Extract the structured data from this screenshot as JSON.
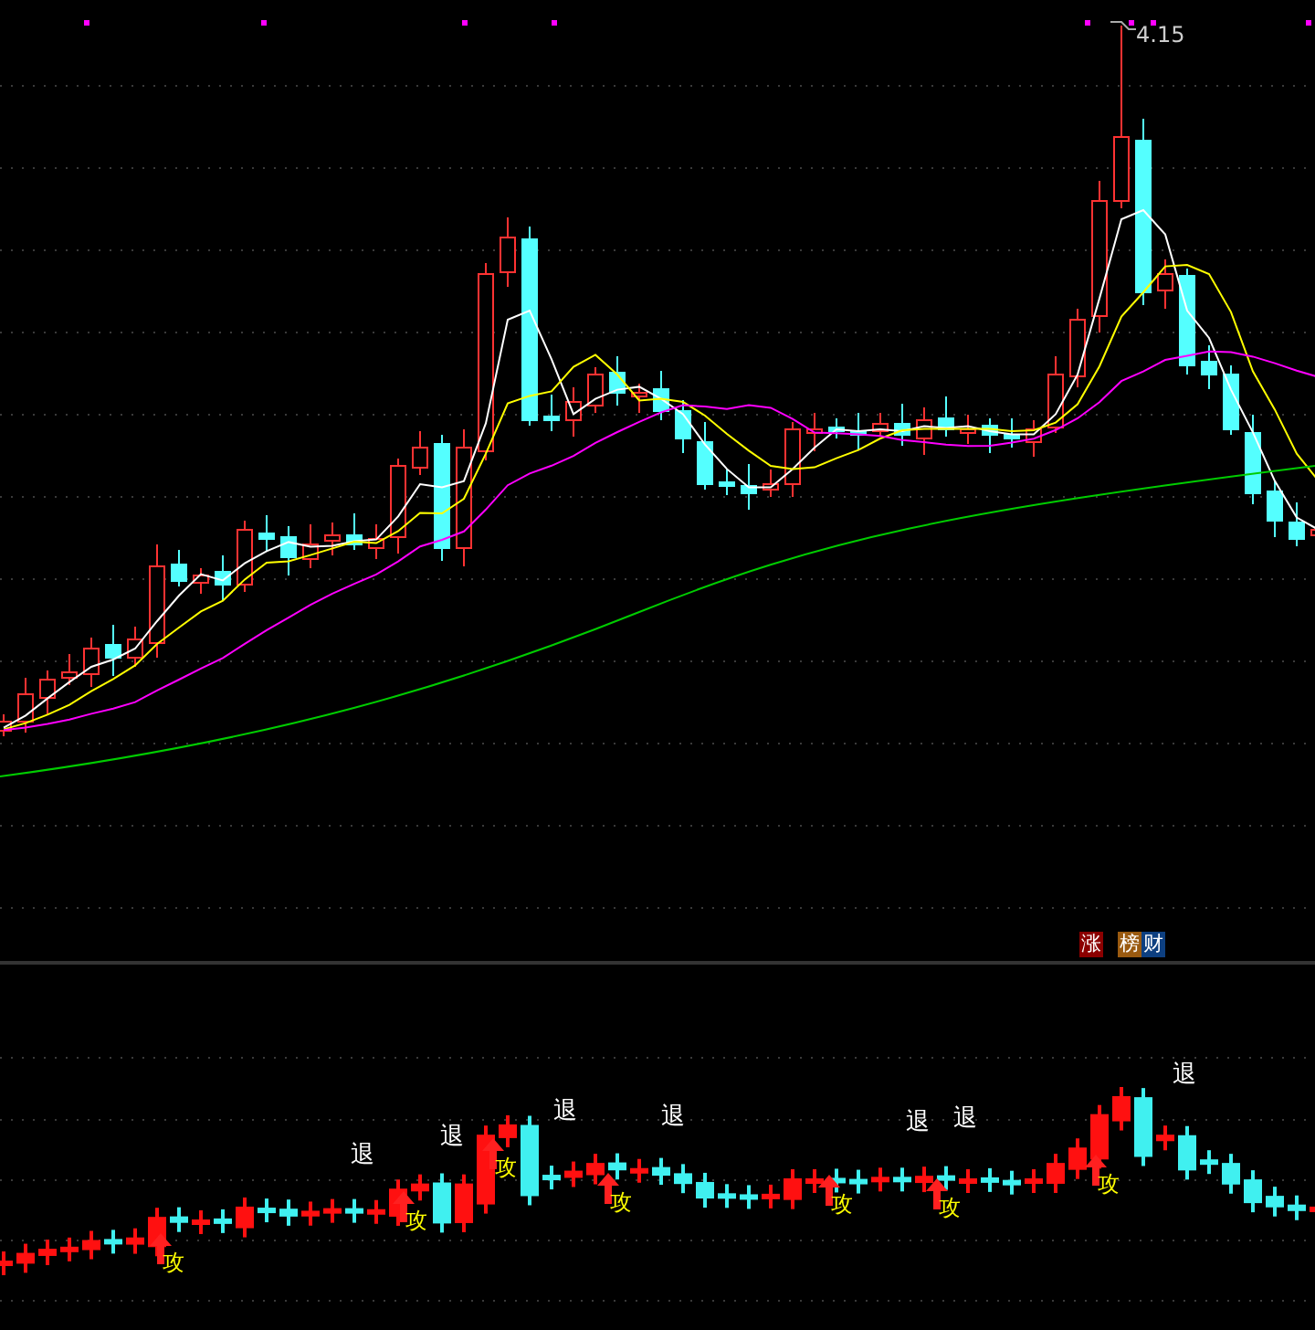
{
  "price_panel": {
    "high_label": "4.15"
  },
  "badges": [
    {
      "text": "涨",
      "color": "#8b0000"
    },
    {
      "text": "榜",
      "color": "#9a5a10"
    },
    {
      "text": "财",
      "color": "#0d3f80"
    }
  ],
  "indicator_panel": {
    "signals": [
      {
        "kind": "attack",
        "text": "攻"
      },
      {
        "kind": "retreat",
        "text": "退"
      },
      {
        "kind": "attack",
        "text": "攻"
      },
      {
        "kind": "retreat",
        "text": "退"
      },
      {
        "kind": "attack",
        "text": "攻"
      },
      {
        "kind": "retreat",
        "text": "退"
      },
      {
        "kind": "attack",
        "text": "攻"
      },
      {
        "kind": "retreat",
        "text": "退"
      },
      {
        "kind": "attack",
        "text": "攻"
      },
      {
        "kind": "retreat",
        "text": "退"
      },
      {
        "kind": "attack",
        "text": "攻"
      },
      {
        "kind": "retreat",
        "text": "退"
      },
      {
        "kind": "attack",
        "text": "攻"
      },
      {
        "kind": "retreat",
        "text": "退"
      }
    ]
  }
}
